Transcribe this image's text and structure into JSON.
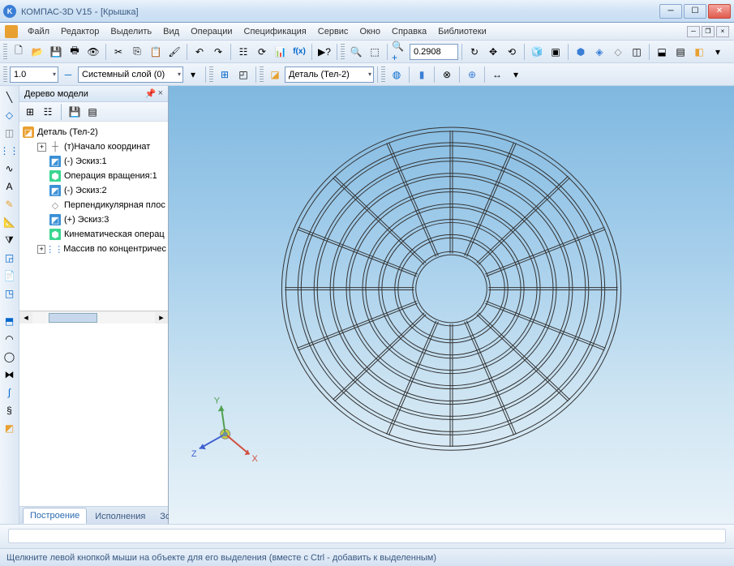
{
  "titlebar": {
    "app": "КОМПАС-3D V15",
    "doc": "[Крышка]",
    "icon_letter": "K"
  },
  "menu": {
    "items": [
      "Файл",
      "Редактор",
      "Выделить",
      "Вид",
      "Операции",
      "Спецификация",
      "Сервис",
      "Окно",
      "Справка",
      "Библиотеки"
    ]
  },
  "toolbar1": {
    "zoom_value": "0.2908"
  },
  "toolbar2": {
    "scale_value": "1.0",
    "layer_label": "Системный слой (0)",
    "part_label": "Деталь (Тел-2)"
  },
  "tree": {
    "title": "Дерево модели",
    "root": "Деталь (Тел-2)",
    "items": [
      {
        "label": "(т)Начало координат",
        "type": "origin",
        "exp": "+"
      },
      {
        "label": "(-) Эскиз:1",
        "type": "sketch"
      },
      {
        "label": "Операция вращения:1",
        "type": "op"
      },
      {
        "label": "(-) Эскиз:2",
        "type": "sketch"
      },
      {
        "label": "Перпендикулярная плос",
        "type": "plane"
      },
      {
        "label": "(+) Эскиз:3",
        "type": "sketch"
      },
      {
        "label": "Кинематическая операц",
        "type": "op"
      },
      {
        "label": "Массив по концентричес",
        "type": "pattern",
        "exp": "+"
      }
    ],
    "tabs": [
      "Построение",
      "Исполнения",
      "Зоны"
    ]
  },
  "status": {
    "hint": "Щелкните левой кнопкой мыши на объекте для его выделения (вместе с Ctrl - добавить к выделенным)"
  },
  "axes": {
    "x": "X",
    "y": "Y",
    "z": "Z"
  }
}
